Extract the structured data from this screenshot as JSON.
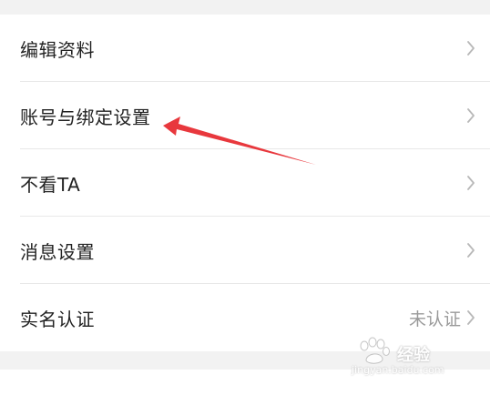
{
  "settings": {
    "items": [
      {
        "label": "编辑资料",
        "value": ""
      },
      {
        "label": "账号与绑定设置",
        "value": ""
      },
      {
        "label": "不看TA",
        "value": ""
      },
      {
        "label": "消息设置",
        "value": ""
      },
      {
        "label": "实名认证",
        "value": "未认证"
      }
    ]
  },
  "icons": {
    "chevron": "chevron-right-icon",
    "annotation": "red-arrow-icon",
    "watermark": "paw-logo"
  },
  "watermark": {
    "brand_text": "经验",
    "url_text": "jingyan.baidu.com"
  },
  "colors": {
    "annotation_arrow": "#e8383d",
    "text_primary": "#222222",
    "text_secondary": "#9a9a9a",
    "chevron": "#b8b8b8",
    "background": "#f2f2f2",
    "card": "#ffffff"
  }
}
